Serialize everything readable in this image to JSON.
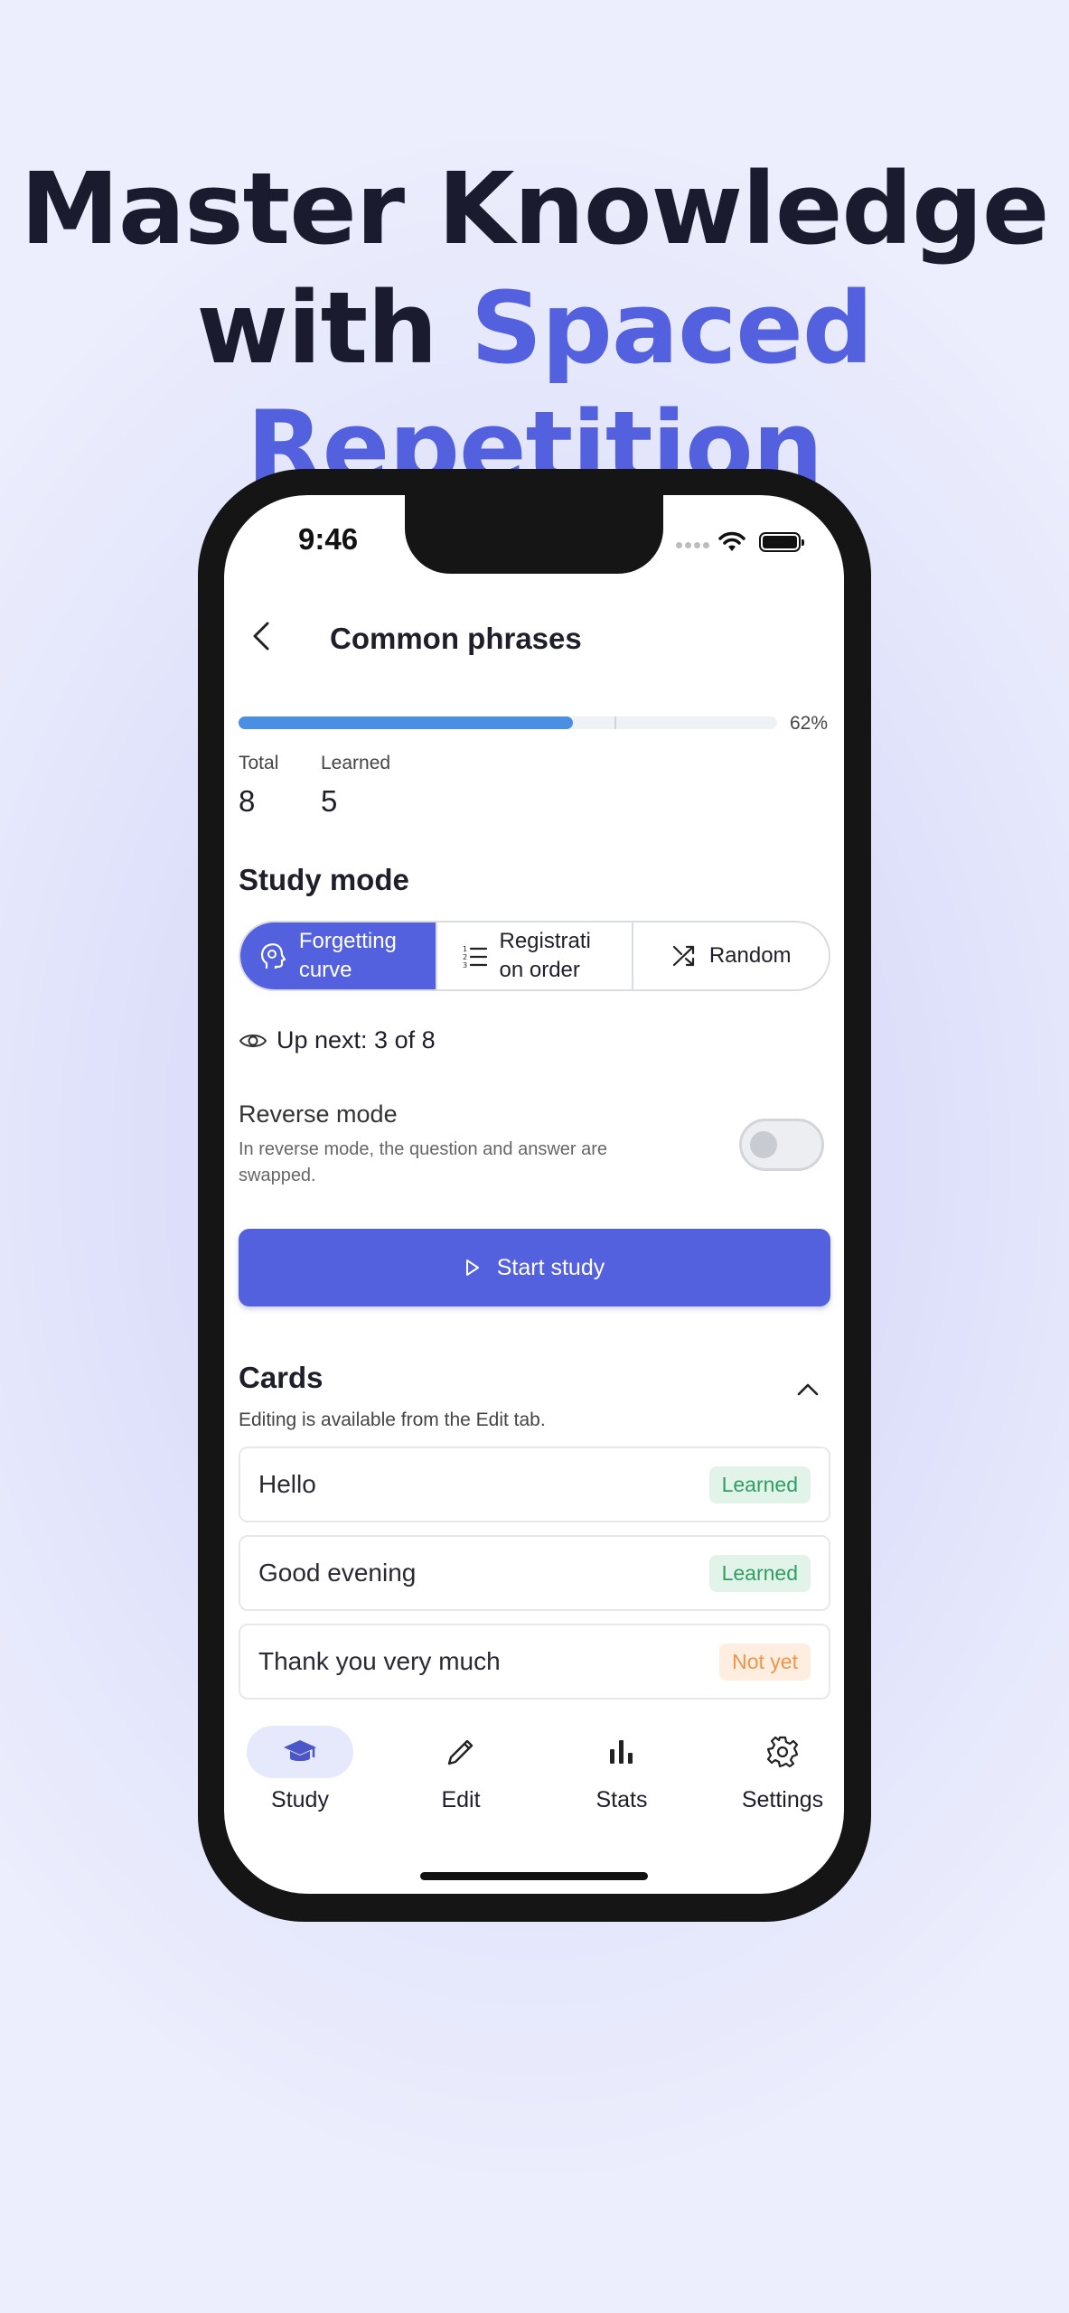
{
  "headline": {
    "line1": "Master Knowledge",
    "line2_prefix": "with ",
    "line2_accent": "Spaced Repetition",
    "accent_color": "#5361de"
  },
  "status_bar": {
    "time": "9:46",
    "icons": [
      "wifi-icon",
      "battery-icon"
    ]
  },
  "header": {
    "back_icon": "chevron-left-icon",
    "title": "Common phrases"
  },
  "progress": {
    "percent_label": "62%",
    "fill_fraction": 0.62,
    "color": "#4a8ee6"
  },
  "stats": {
    "total_label": "Total",
    "total_value": "8",
    "learned_label": "Learned",
    "learned_value": "5"
  },
  "study_mode": {
    "title": "Study mode",
    "options": [
      {
        "label": "Forgetting curve",
        "icon": "brain-head-icon",
        "selected": true
      },
      {
        "label": "Registrati on order",
        "icon": "numbered-list-icon",
        "selected": false
      },
      {
        "label": "Random",
        "icon": "shuffle-icon",
        "selected": false
      }
    ]
  },
  "up_next": {
    "icon": "eye-icon",
    "text": "Up next: 3 of 8"
  },
  "reverse_mode": {
    "title": "Reverse mode",
    "description": "In reverse mode, the question and answer are swapped.",
    "enabled": false
  },
  "start_button": {
    "label": "Start study",
    "icon": "play-icon",
    "color": "#5361de"
  },
  "cards": {
    "title": "Cards",
    "subtitle": "Editing is available from the Edit tab.",
    "collapse_icon": "chevron-up-icon",
    "items": [
      {
        "text": "Hello",
        "status": "Learned"
      },
      {
        "text": "Good evening",
        "status": "Learned"
      },
      {
        "text": "Thank you very much",
        "status": "Not yet"
      }
    ]
  },
  "tabbar": {
    "items": [
      {
        "label": "Study",
        "icon": "graduation-cap-icon",
        "active": true
      },
      {
        "label": "Edit",
        "icon": "pencil-icon",
        "active": false
      },
      {
        "label": "Stats",
        "icon": "bar-chart-icon",
        "active": false
      },
      {
        "label": "Settings",
        "icon": "gear-icon",
        "active": false
      }
    ]
  }
}
